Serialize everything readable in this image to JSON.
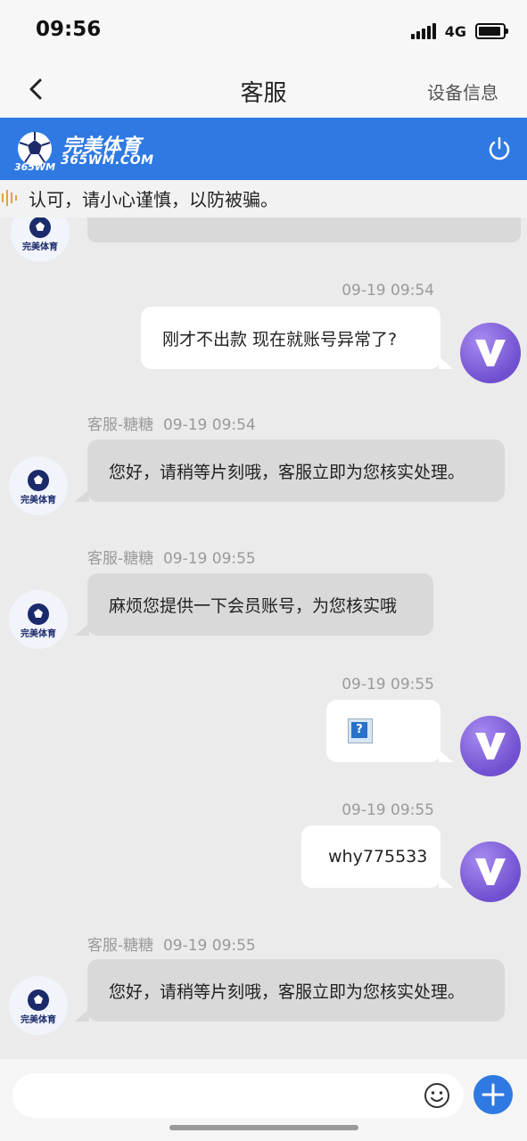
{
  "status_bar": {
    "time": "09:56",
    "network": "4G"
  },
  "nav": {
    "title": "客服",
    "right_label": "设备信息"
  },
  "brand": {
    "name": "完美体育",
    "domain": "365WM.COM",
    "avatar_caption": "完美体育",
    "avatar_mark": "365WM"
  },
  "notice": {
    "text": "认可，请小心谨慎，以防被骗。"
  },
  "messages": [
    {
      "side": "right",
      "time": "09-19 09:54",
      "text": "刚才不出款 现在就账号异常了?"
    },
    {
      "side": "left",
      "sender": "客服-糖糖",
      "time": "09-19 09:54",
      "text": "您好，请稍等片刻哦，客服立即为您核实处理。"
    },
    {
      "side": "left",
      "sender": "客服-糖糖",
      "time": "09-19 09:55",
      "text": "麻烦您提供一下会员账号，为您核实哦"
    },
    {
      "side": "right",
      "time": "09-19 09:55",
      "image": "?"
    },
    {
      "side": "right",
      "time": "09-19 09:55",
      "text": "why775533"
    },
    {
      "side": "left",
      "sender": "客服-糖糖",
      "time": "09-19 09:55",
      "text": "您好，请稍等片刻哦，客服立即为您核实处理。"
    }
  ],
  "colors": {
    "brand_blue": "#2f79e2",
    "avatar_purple": "#7050d0",
    "chat_bg": "#ebebeb"
  },
  "icons": {
    "back": "chevron-left-icon",
    "power": "power-icon",
    "emoji": "smiley-icon",
    "plus": "plus-icon",
    "notice": "sound-wave-icon"
  }
}
